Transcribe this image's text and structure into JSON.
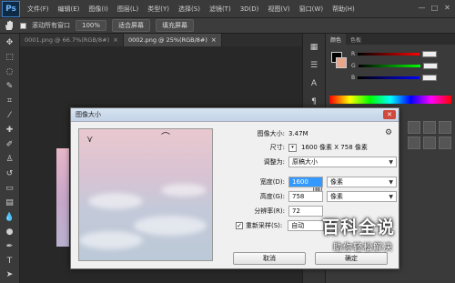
{
  "app": {
    "logo": "Ps",
    "accent": "#3d7fcc"
  },
  "menubar": {
    "items": [
      "文件(F)",
      "编辑(E)",
      "图像(I)",
      "图层(L)",
      "类型(Y)",
      "选择(S)",
      "滤镜(T)",
      "3D(D)",
      "视图(V)",
      "窗口(W)",
      "帮助(H)"
    ],
    "window_buttons": [
      "—",
      "□",
      "✕"
    ]
  },
  "options": {
    "scroll_all_windows": "滚动所有窗口",
    "btn_100": "100%",
    "btn_fit": "适合屏幕",
    "btn_fill": "填充屏幕"
  },
  "tabs": [
    {
      "label": "0001.png @ 66.7%(RGB/8#)",
      "close": "×"
    },
    {
      "label": "0002.png @ 25%(RGB/8#)",
      "close": "×"
    }
  ],
  "panel": {
    "tabs": [
      "颜色",
      "色板"
    ],
    "sliders": [
      {
        "label": "R",
        "color": "#e22"
      },
      {
        "label": "G",
        "color": "#2c2"
      },
      {
        "label": "B",
        "color": "#35f"
      }
    ],
    "fg_color": "#000000",
    "bg_color": "#e7a58c"
  },
  "dialog": {
    "title": "图像大小",
    "close": "✕",
    "image_size_label": "图像大小:",
    "image_size_value": "3.47M",
    "dimensions_label": "尺寸:",
    "dimensions_value": "1600 像素  X  758 像素",
    "fit_to_label": "调整为:",
    "fit_to_value": "原稿大小",
    "width_label": "宽度(D):",
    "width_value": "1600",
    "width_unit": "像素",
    "height_label": "高度(G):",
    "height_value": "758",
    "height_unit": "像素",
    "resolution_label": "分辨率(R):",
    "resolution_value": "72",
    "resample_label": "重新采样(S):",
    "resample_value": "自动",
    "cancel": "取消",
    "ok": "确定"
  },
  "watermark": {
    "title": "百科全说",
    "subtitle": "助你轻松解决"
  }
}
